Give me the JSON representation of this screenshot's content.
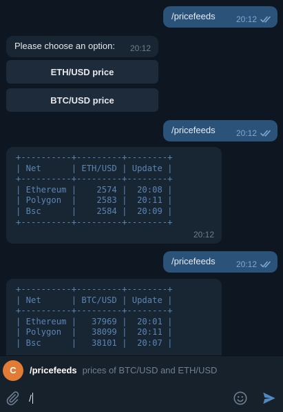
{
  "messages": {
    "out1": {
      "text": "/pricefeeds",
      "time": "20:12"
    },
    "prompt": {
      "text": "Please choose an option:",
      "time": "20:12"
    },
    "keyboard": [
      "ETH/USD price",
      "BTC/USD price"
    ],
    "out2": {
      "text": "/pricefeeds",
      "time": "20:12"
    },
    "eth_table": {
      "text": "+----------+---------+--------+\n| Net      | ETH/USD | Update |\n+----------+---------+--------+\n| Ethereum |    2574 |  20:08 |\n| Polygon  |    2583 |  20:11 |\n| Bsc      |    2584 |  20:09 |\n+----------+---------+--------+",
      "time": "20:12"
    },
    "out3": {
      "text": "/pricefeeds",
      "time": "20:12"
    },
    "btc_table": {
      "text": "+----------+---------+--------+\n| Net      | BTC/USD | Update |\n+----------+---------+--------+\n| Ethereum |   37969 |  20:01 |\n| Polygon  |   38099 |  20:11 |\n| Bsc      |   38101 |  20:07 |"
    }
  },
  "suggestion": {
    "avatar_letter": "C",
    "command": "/pricefeeds",
    "description": "prices of BTC/USD and ETH/USD"
  },
  "composer": {
    "value": "/",
    "icons": [
      "paperclip-icon",
      "emoji-icon",
      "send-icon"
    ]
  },
  "colors": {
    "background": "#0e1621",
    "outgoing": "#2b5278",
    "incoming": "#182533",
    "accent": "#5288c1",
    "avatar": "#e17b35"
  }
}
